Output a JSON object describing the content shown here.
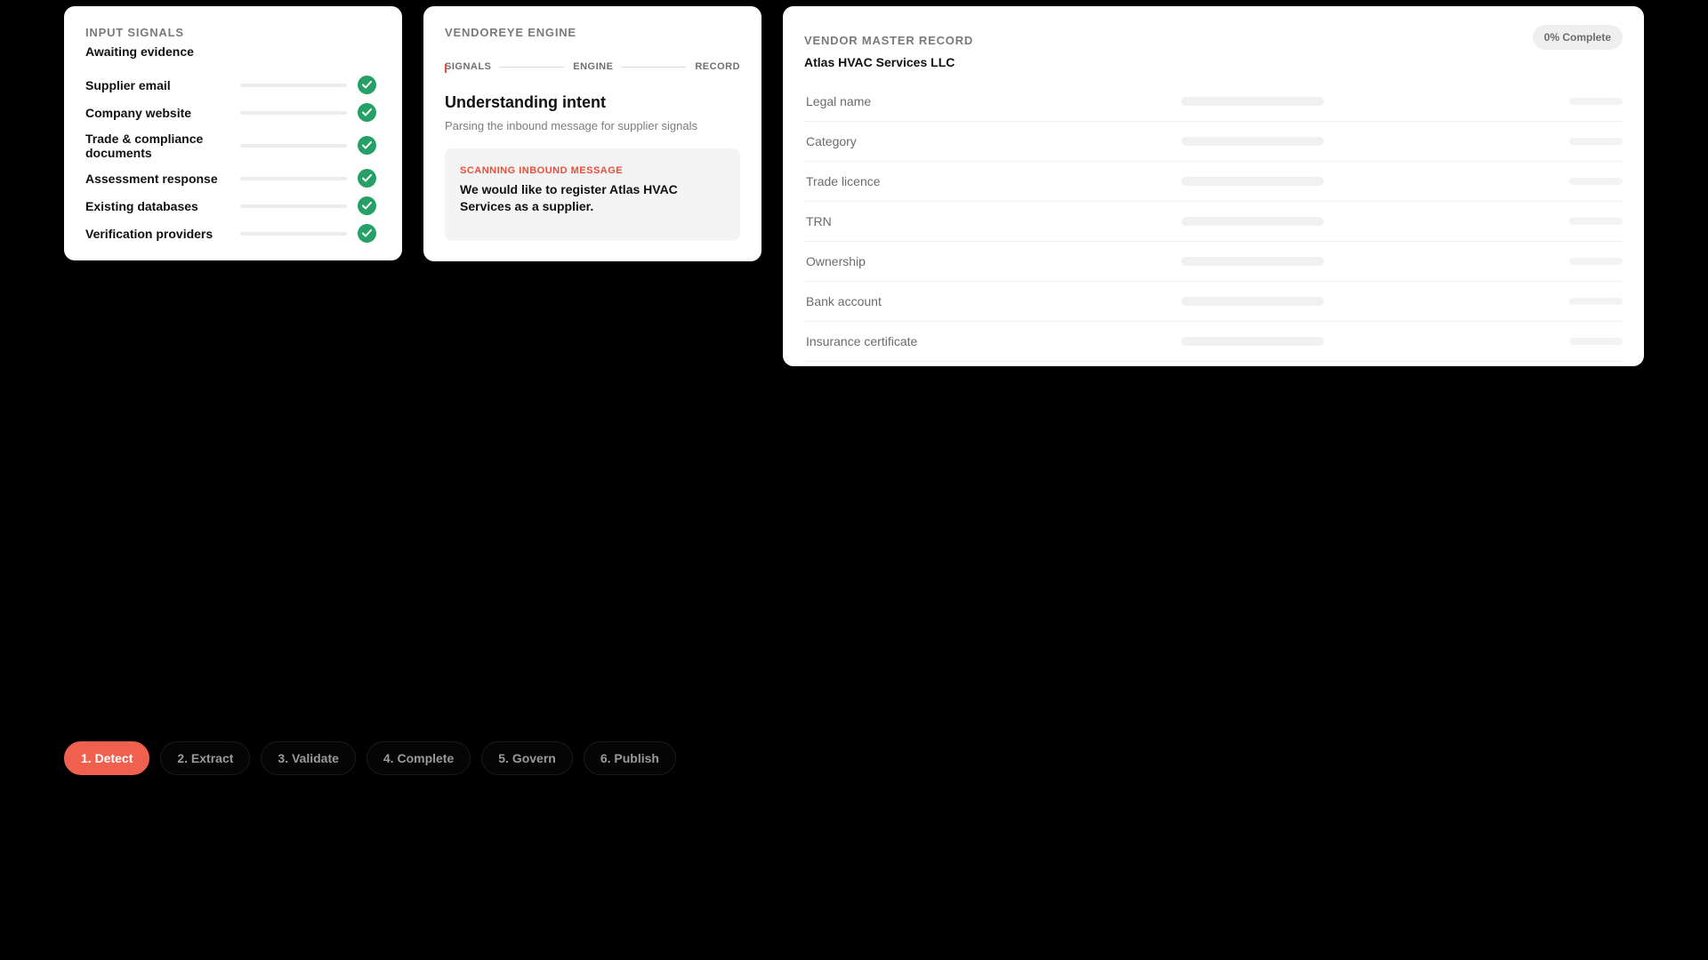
{
  "colors": {
    "background": "#000000",
    "card": "#ffffff",
    "accent": "#f0604f",
    "scan_label": "#e8503a",
    "check": "#27a067"
  },
  "input_signals": {
    "eyebrow": "INPUT SIGNALS",
    "status": "Awaiting evidence",
    "items": [
      {
        "label": "Supplier email",
        "icon": "check-circle-icon"
      },
      {
        "label": "Company website",
        "icon": "check-circle-icon"
      },
      {
        "label": "Trade & compliance documents",
        "icon": "check-circle-icon"
      },
      {
        "label": "Assessment response",
        "icon": "check-circle-icon"
      },
      {
        "label": "Existing databases",
        "icon": "check-circle-icon"
      },
      {
        "label": "Verification providers",
        "icon": "check-circle-icon"
      }
    ]
  },
  "engine": {
    "eyebrow": "VENDOREYE ENGINE",
    "steps": [
      "SIGNALS",
      "ENGINE",
      "RECORD"
    ],
    "title": "Understanding intent",
    "description": "Parsing the inbound message for supplier signals",
    "scan_label": "SCANNING INBOUND MESSAGE",
    "scan_message": "We would like to register  Atlas HVAC Services  as a supplier."
  },
  "vendor_record": {
    "eyebrow": "VENDOR MASTER RECORD",
    "completion": "0% Complete",
    "vendor_name": "Atlas HVAC Services LLC",
    "fields": [
      "Legal name",
      "Category",
      "Trade licence",
      "TRN",
      "Ownership",
      "Bank account",
      "Insurance certificate"
    ]
  },
  "stages": {
    "active_index": 0,
    "items": [
      "1. Detect",
      "2. Extract",
      "3. Validate",
      "4. Complete",
      "5. Govern",
      "6. Publish"
    ]
  }
}
